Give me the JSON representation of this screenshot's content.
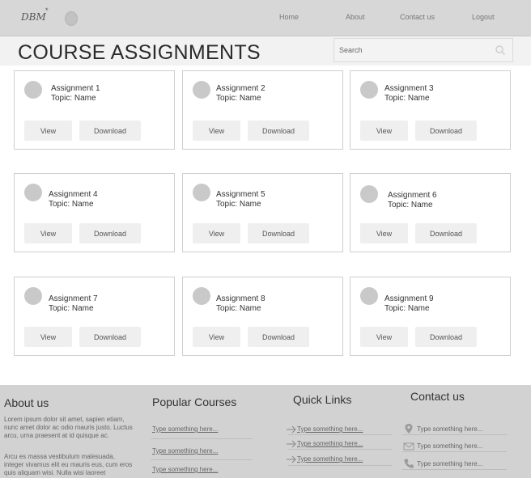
{
  "header": {
    "logo_text": "DBM",
    "logo_mark": "*",
    "nav": [
      "Home",
      "About",
      "Contact us",
      "Logout"
    ]
  },
  "page": {
    "title": "COURSE ASSIGNMENTS"
  },
  "search": {
    "placeholder": "Search",
    "icon": "search-icon"
  },
  "assignments": [
    {
      "name": "Assignment 1",
      "topic": "Topic: Name",
      "view_label": "View",
      "download_label": "Download"
    },
    {
      "name": "Assignment 2",
      "topic": "Topic: Name",
      "view_label": "View",
      "download_label": "Download"
    },
    {
      "name": "Assignment 3",
      "topic": "Topic: Name",
      "view_label": "View",
      "download_label": "Download"
    },
    {
      "name": "Assignment 4",
      "topic": "Topic: Name",
      "view_label": "View",
      "download_label": "Download"
    },
    {
      "name": "Assignment 5",
      "topic": "Topic: Name",
      "view_label": "View",
      "download_label": "Download"
    },
    {
      "name": "Assignment 6",
      "topic": "Topic: Name",
      "view_label": "View",
      "download_label": "Download"
    },
    {
      "name": "Assignment 7",
      "topic": "Topic: Name",
      "view_label": "View",
      "download_label": "Download"
    },
    {
      "name": "Assignment 8",
      "topic": "Topic: Name",
      "view_label": "View",
      "download_label": "Download"
    },
    {
      "name": "Assignment 9",
      "topic": "Topic: Name",
      "view_label": "View",
      "download_label": "Download"
    }
  ],
  "footer": {
    "about": {
      "title": "About us",
      "paragraph1": "Lorem ipsum dolor sit amet, sapien etiam, nunc amet dolor ac odio mauris justo. Luctus arcu, urna praesent at id quisque ac.",
      "paragraph2": "Arcu es massa vestibulum malesuada, integer vivamus elit eu mauris eus, cum eros quis aliquam wisi. Nulla wisi laoreet"
    },
    "popular": {
      "title": "Popular Courses",
      "items": [
        "Type something here...",
        "Type something here...",
        "Type something here..."
      ]
    },
    "quick": {
      "title": "Quick Links",
      "items": [
        "Type something here...",
        "Type something here...",
        "Type something here..."
      ]
    },
    "contact": {
      "title": "Contact us",
      "items": [
        "Type something here...",
        "Type something here...",
        "Type something here..."
      ]
    }
  },
  "colors": {
    "header_bg": "#d7d7d7",
    "titlebar_bg": "#f2f2f2",
    "footer_bg": "#d2d2d2",
    "button_bg": "#efefef"
  }
}
